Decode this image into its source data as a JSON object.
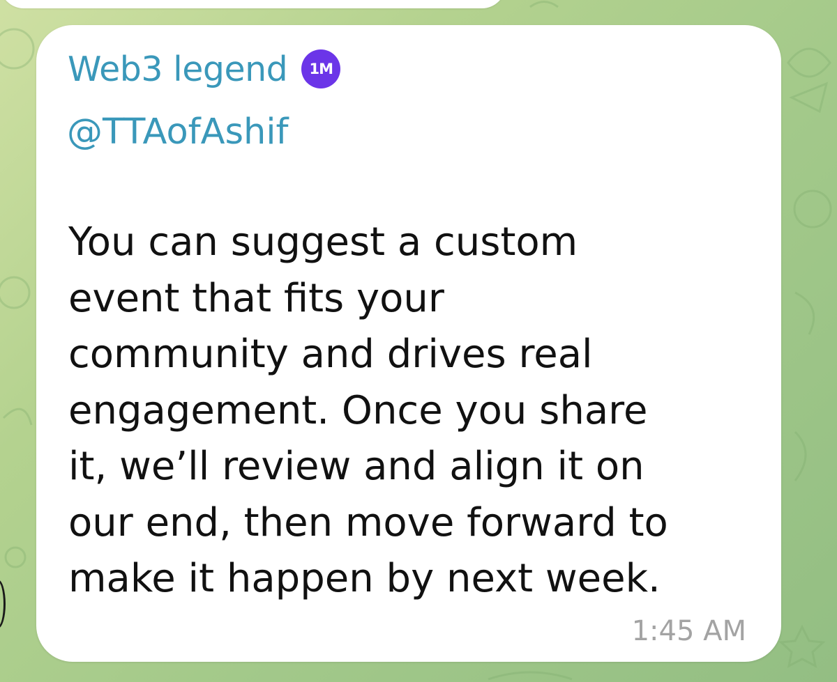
{
  "message": {
    "sender_name": "Web3 legend",
    "badge_label": "1M",
    "badge_color": "#6b35e8",
    "username": "@TTAofAshif",
    "body_lines": [
      "You can suggest a custom",
      "event that fits your",
      "community and drives real",
      "engagement. Once you share",
      "it, we’ll review and align it on",
      "our end, then move forward to",
      "make it happen by next week."
    ],
    "time": "1:45 AM"
  },
  "colors": {
    "name_accent": "#3a98ba",
    "bubble": "#ffffff",
    "text": "#111111",
    "timestamp": "#a3a3a3",
    "chat_background": "#a3c98a"
  },
  "icons": {
    "badge": "premium-badge-icon",
    "background": "doodle-pattern"
  }
}
